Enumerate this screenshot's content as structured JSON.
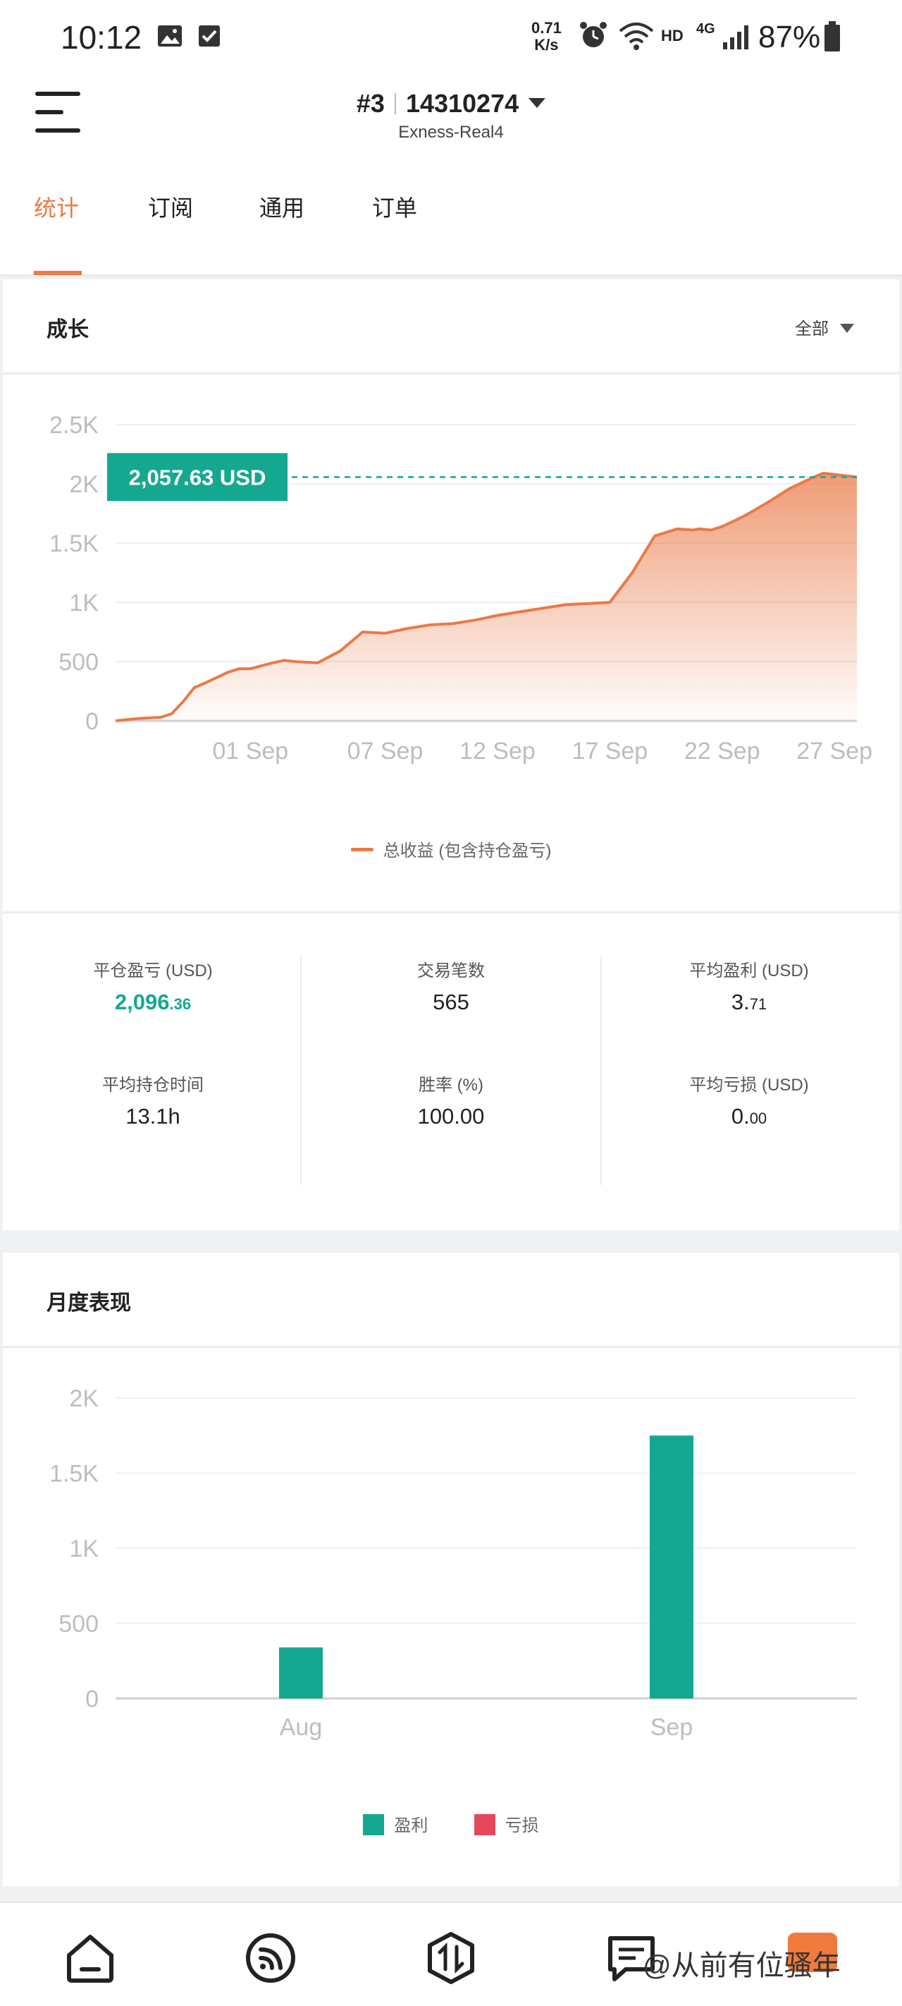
{
  "status_bar": {
    "time": "10:12",
    "speed_value": "0.71",
    "speed_unit": "K/s",
    "hd": "HD",
    "network": "4G",
    "battery": "87%"
  },
  "header": {
    "account_number": "#3",
    "account_id": "14310274",
    "server": "Exness-Real4"
  },
  "tabs": [
    {
      "label": "统计",
      "active": true
    },
    {
      "label": "订阅",
      "active": false
    },
    {
      "label": "通用",
      "active": false
    },
    {
      "label": "订单",
      "active": false
    }
  ],
  "growth": {
    "title": "成长",
    "filter_label": "全部",
    "current_value_label": "2,057.63 USD",
    "legend": "总收益 (包含持仓盈亏)"
  },
  "stats": [
    {
      "label": "平仓盈亏 (USD)",
      "value_main": "2,096",
      "value_frac": ".36",
      "accent": true
    },
    {
      "label": "交易笔数",
      "value_main": "565",
      "value_frac": "",
      "accent": false
    },
    {
      "label": "平均盈利 (USD)",
      "value_main": "3.",
      "value_frac": "71",
      "accent": false
    },
    {
      "label": "平均持仓时间",
      "value_main": "13.1h",
      "value_frac": "",
      "accent": false
    },
    {
      "label": "胜率 (%)",
      "value_main": "100.00",
      "value_frac": "",
      "accent": false
    },
    {
      "label": "平均亏损 (USD)",
      "value_main": "0.",
      "value_frac": "00",
      "accent": false
    }
  ],
  "monthly": {
    "title": "月度表现",
    "legend_profit": "盈利",
    "legend_loss": "亏损"
  },
  "bottom_nav": {
    "watermark": "@从前有位骚年"
  },
  "colors": {
    "accent_orange": "#ea7a47",
    "profit_teal": "#15a891",
    "loss_red": "#e5475a"
  },
  "chart_data": [
    {
      "type": "area",
      "title": "成长",
      "x_tick_labels": [
        "01 Sep",
        "07 Sep",
        "12 Sep",
        "17 Sep",
        "22 Sep",
        "27 Sep"
      ],
      "x_tick_positions": [
        6,
        12,
        17,
        22,
        27,
        32
      ],
      "y_tick_labels": [
        "0",
        "500",
        "1K",
        "1.5K",
        "2K",
        "2.5K"
      ],
      "ylim": [
        0,
        2500
      ],
      "xlim": [
        0,
        33
      ],
      "grid": true,
      "legend_position": "bottom",
      "series": [
        {
          "name": "总收益 (包含持仓盈亏)",
          "x": [
            0,
            1,
            2,
            2.5,
            3,
            3.5,
            4,
            5,
            5.5,
            6,
            7,
            7.5,
            8,
            9,
            10,
            11,
            12,
            12.5,
            13,
            14,
            15,
            16,
            17,
            18,
            19,
            20,
            21,
            22,
            23,
            24,
            25,
            25.7,
            26,
            26.5,
            27,
            28,
            29,
            30,
            31,
            31.5,
            32,
            33
          ],
          "y": [
            0,
            20,
            30,
            60,
            160,
            280,
            320,
            410,
            440,
            440,
            490,
            510,
            500,
            490,
            590,
            750,
            740,
            760,
            780,
            810,
            820,
            850,
            890,
            920,
            950,
            980,
            990,
            1000,
            1250,
            1560,
            1620,
            1610,
            1620,
            1610,
            1640,
            1730,
            1840,
            1960,
            2050,
            2090,
            2080,
            2057.63
          ]
        }
      ],
      "annotation": {
        "label": "2,057.63 USD",
        "y": 2057.63
      }
    },
    {
      "type": "bar",
      "title": "月度表现",
      "categories": [
        "Aug",
        "Sep"
      ],
      "y_tick_labels": [
        "0",
        "500",
        "1K",
        "1.5K",
        "2K"
      ],
      "ylim": [
        0,
        2000
      ],
      "grid": true,
      "legend_position": "bottom",
      "series": [
        {
          "name": "盈利",
          "values": [
            340,
            1750
          ],
          "color": "#15a891"
        },
        {
          "name": "亏损",
          "values": [
            0,
            0
          ],
          "color": "#e5475a"
        }
      ]
    }
  ]
}
